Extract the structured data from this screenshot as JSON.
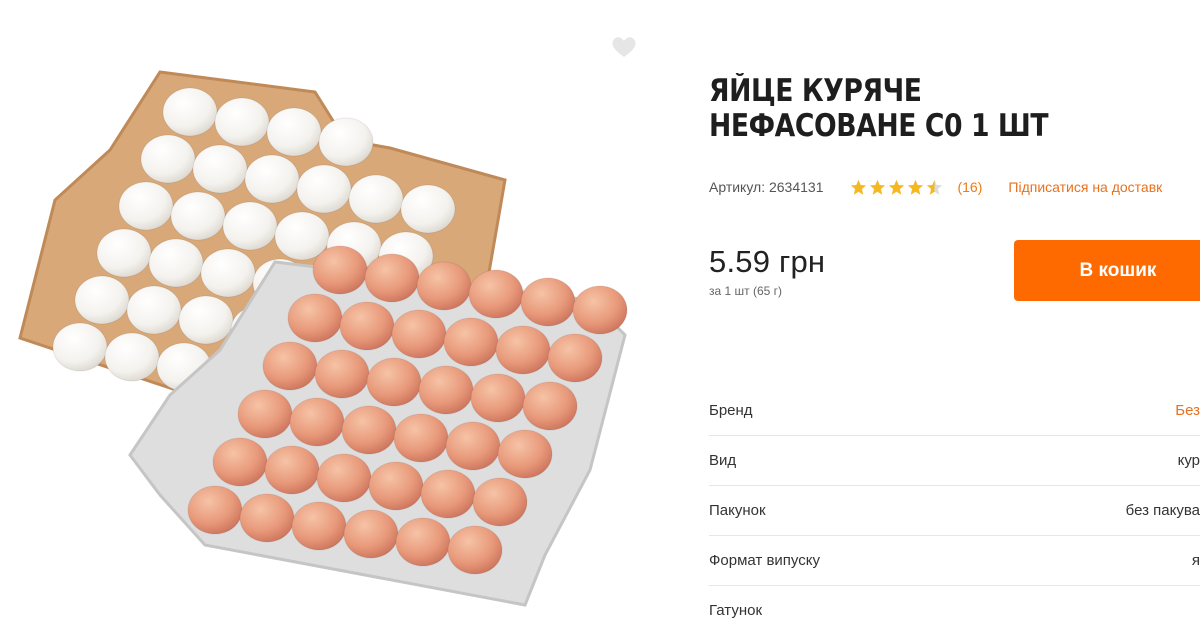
{
  "product": {
    "title": "ЯЙЦЕ КУРЯЧЕ НЕФАСОВАНЕ С0 1 ШТ",
    "article": "Артикул: 2634131",
    "rating": 4.5,
    "reviews": "(16)",
    "subscribe_link": "Підписатися на доставк",
    "price": "5.59 грн",
    "unit_info": "за 1 шт (65 г)",
    "cart_button": "В кошик"
  },
  "icons": {
    "wishlist": "heart-icon",
    "rating": "star-icon"
  },
  "colors": {
    "accent": "#ff6a00",
    "link": "#e8711e",
    "star": "#f5b820"
  },
  "specs": [
    {
      "label": "Бренд",
      "value": "Без"
    },
    {
      "label": "Вид",
      "value": "кур"
    },
    {
      "label": "Пакунок",
      "value": "без пакува"
    },
    {
      "label": "Формат випуску",
      "value": "я"
    },
    {
      "label": "Гатунок",
      "value": ""
    }
  ]
}
